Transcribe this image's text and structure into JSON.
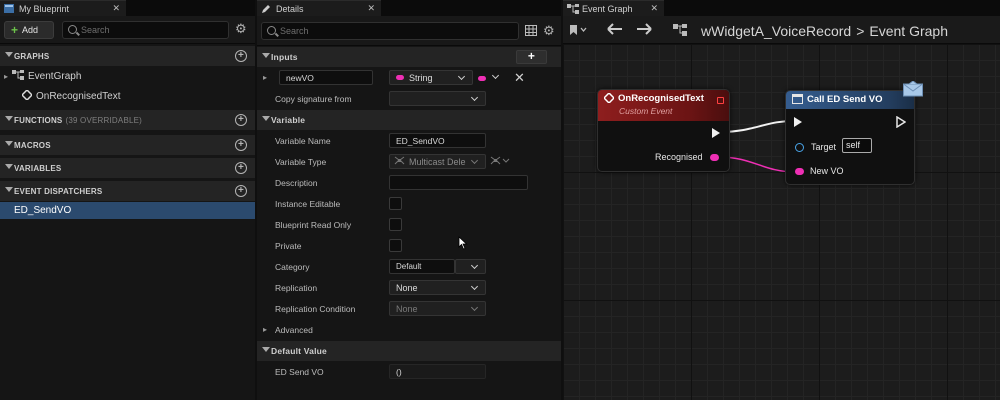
{
  "left_panel": {
    "tab_title": "My Blueprint",
    "add_label": "Add",
    "search_placeholder": "Search",
    "sections": {
      "graphs": "GRAPHS",
      "functions": "FUNCTIONS",
      "functions_sub": "(39 OVERRIDABLE)",
      "macros": "MACROS",
      "variables": "VARIABLES",
      "event_dispatchers": "EVENT DISPATCHERS"
    },
    "graph_items": [
      "EventGraph",
      "OnRecognisedText"
    ],
    "dispatcher_items": [
      "ED_SendVO"
    ]
  },
  "details_panel": {
    "tab_title": "Details",
    "search_placeholder": "Search",
    "inputs_header": "Inputs",
    "input_name": "newVO",
    "input_type": "String",
    "copy_signature_label": "Copy signature from",
    "variable_header": "Variable",
    "properties": {
      "variable_name_label": "Variable Name",
      "variable_name_value": "ED_SendVO",
      "variable_type_label": "Variable Type",
      "variable_type_value": "Multicast Dele",
      "description_label": "Description",
      "instance_editable_label": "Instance Editable",
      "blueprint_read_only_label": "Blueprint Read Only",
      "private_label": "Private",
      "category_label": "Category",
      "category_value": "Default",
      "replication_label": "Replication",
      "replication_value": "None",
      "replication_condition_label": "Replication Condition",
      "replication_condition_value": "None"
    },
    "advanced_label": "Advanced",
    "default_value_header": "Default Value",
    "default_param_label": "ED Send VO",
    "default_param_value": "()"
  },
  "graph_panel": {
    "tab_title": "Event Graph",
    "breadcrumb_blueprint": "wWidgetA_VoiceRecord",
    "breadcrumb_separator": ">",
    "breadcrumb_graph": "Event Graph",
    "event_node": {
      "title": "OnRecognisedText",
      "subtitle": "Custom Event",
      "output_pin": "Recognised"
    },
    "call_node": {
      "title": "Call ED Send VO",
      "target_label": "Target",
      "target_value": "self",
      "input_pin": "New VO"
    }
  },
  "colors": {
    "string_pin": "#ee2fb4",
    "event_header": "#8e1e1e",
    "function_header": "#355d8f",
    "selection": "#2b4a6e"
  }
}
